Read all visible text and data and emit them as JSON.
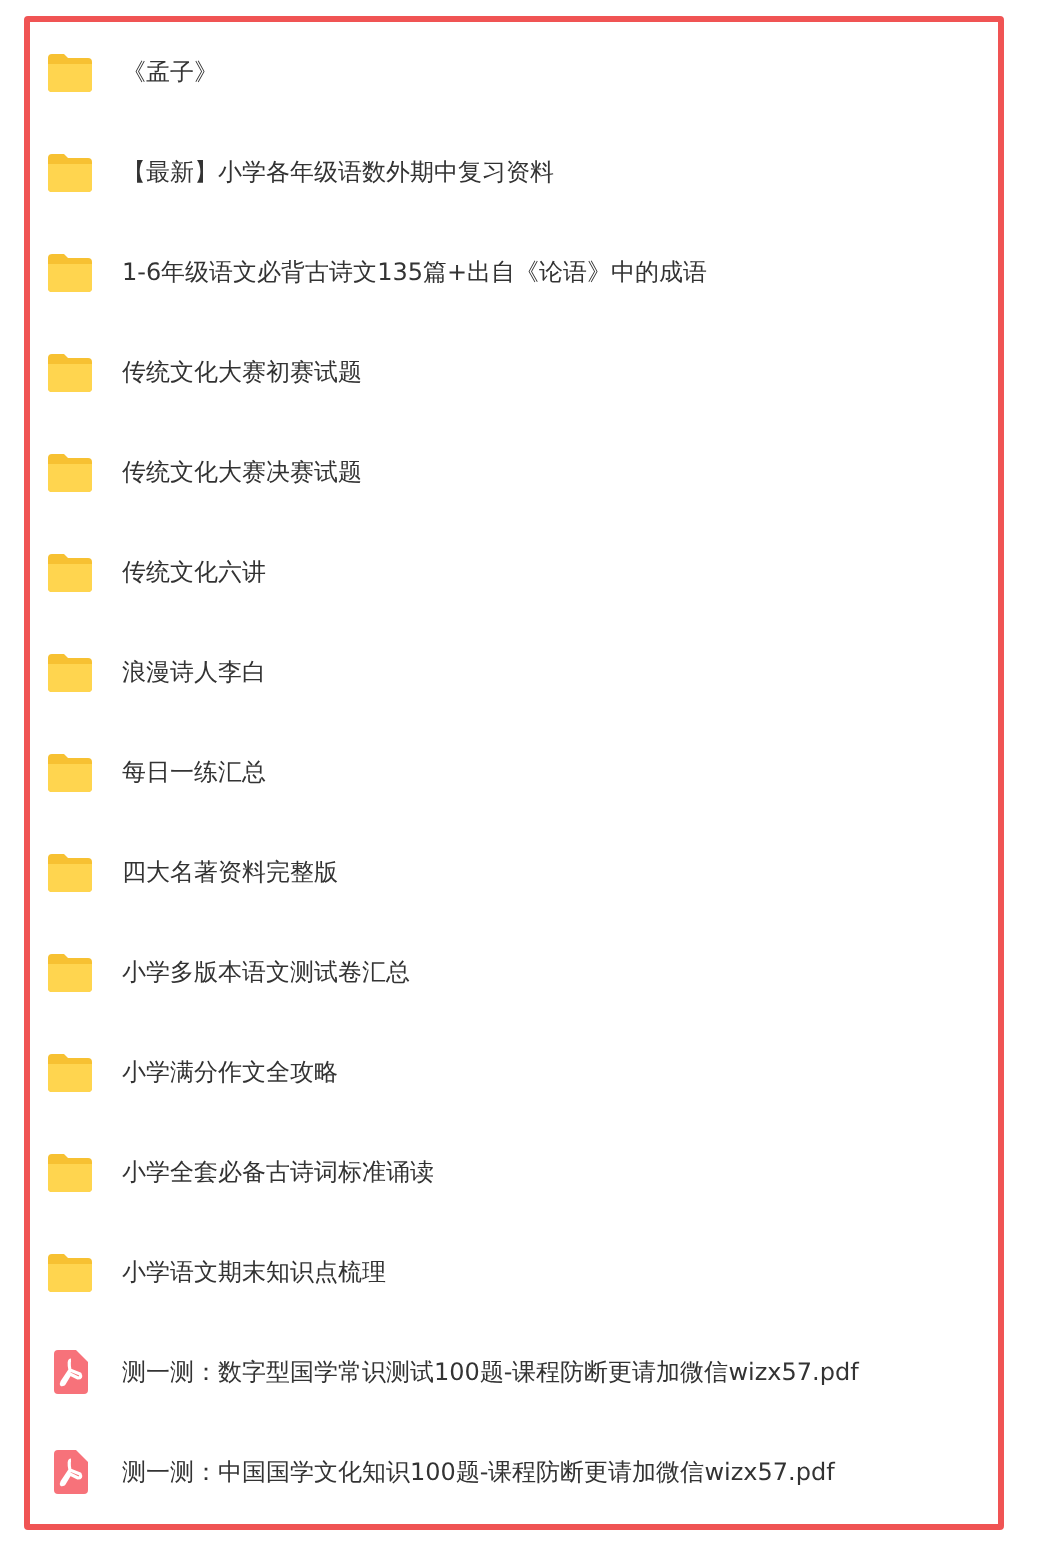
{
  "files": [
    {
      "kind": "folder",
      "name": "《孟子》"
    },
    {
      "kind": "folder",
      "name": "【最新】小学各年级语数外期中复习资料"
    },
    {
      "kind": "folder",
      "name": "1-6年级语文必背古诗文135篇+出自《论语》中的成语"
    },
    {
      "kind": "folder",
      "name": "传统文化大赛初赛试题"
    },
    {
      "kind": "folder",
      "name": "传统文化大赛决赛试题"
    },
    {
      "kind": "folder",
      "name": "传统文化六讲"
    },
    {
      "kind": "folder",
      "name": "浪漫诗人李白"
    },
    {
      "kind": "folder",
      "name": "每日一练汇总"
    },
    {
      "kind": "folder",
      "name": "四大名著资料完整版"
    },
    {
      "kind": "folder",
      "name": "小学多版本语文测试卷汇总"
    },
    {
      "kind": "folder",
      "name": "小学满分作文全攻略"
    },
    {
      "kind": "folder",
      "name": "小学全套必备古诗词标准诵读"
    },
    {
      "kind": "folder",
      "name": "小学语文期末知识点梳理"
    },
    {
      "kind": "pdf",
      "name": "测一测：数字型国学常识测试100题-课程防断更请加微信wizx57.pdf"
    },
    {
      "kind": "pdf",
      "name": "测一测：中国国学文化知识100题-课程防断更请加微信wizx57.pdf"
    }
  ]
}
